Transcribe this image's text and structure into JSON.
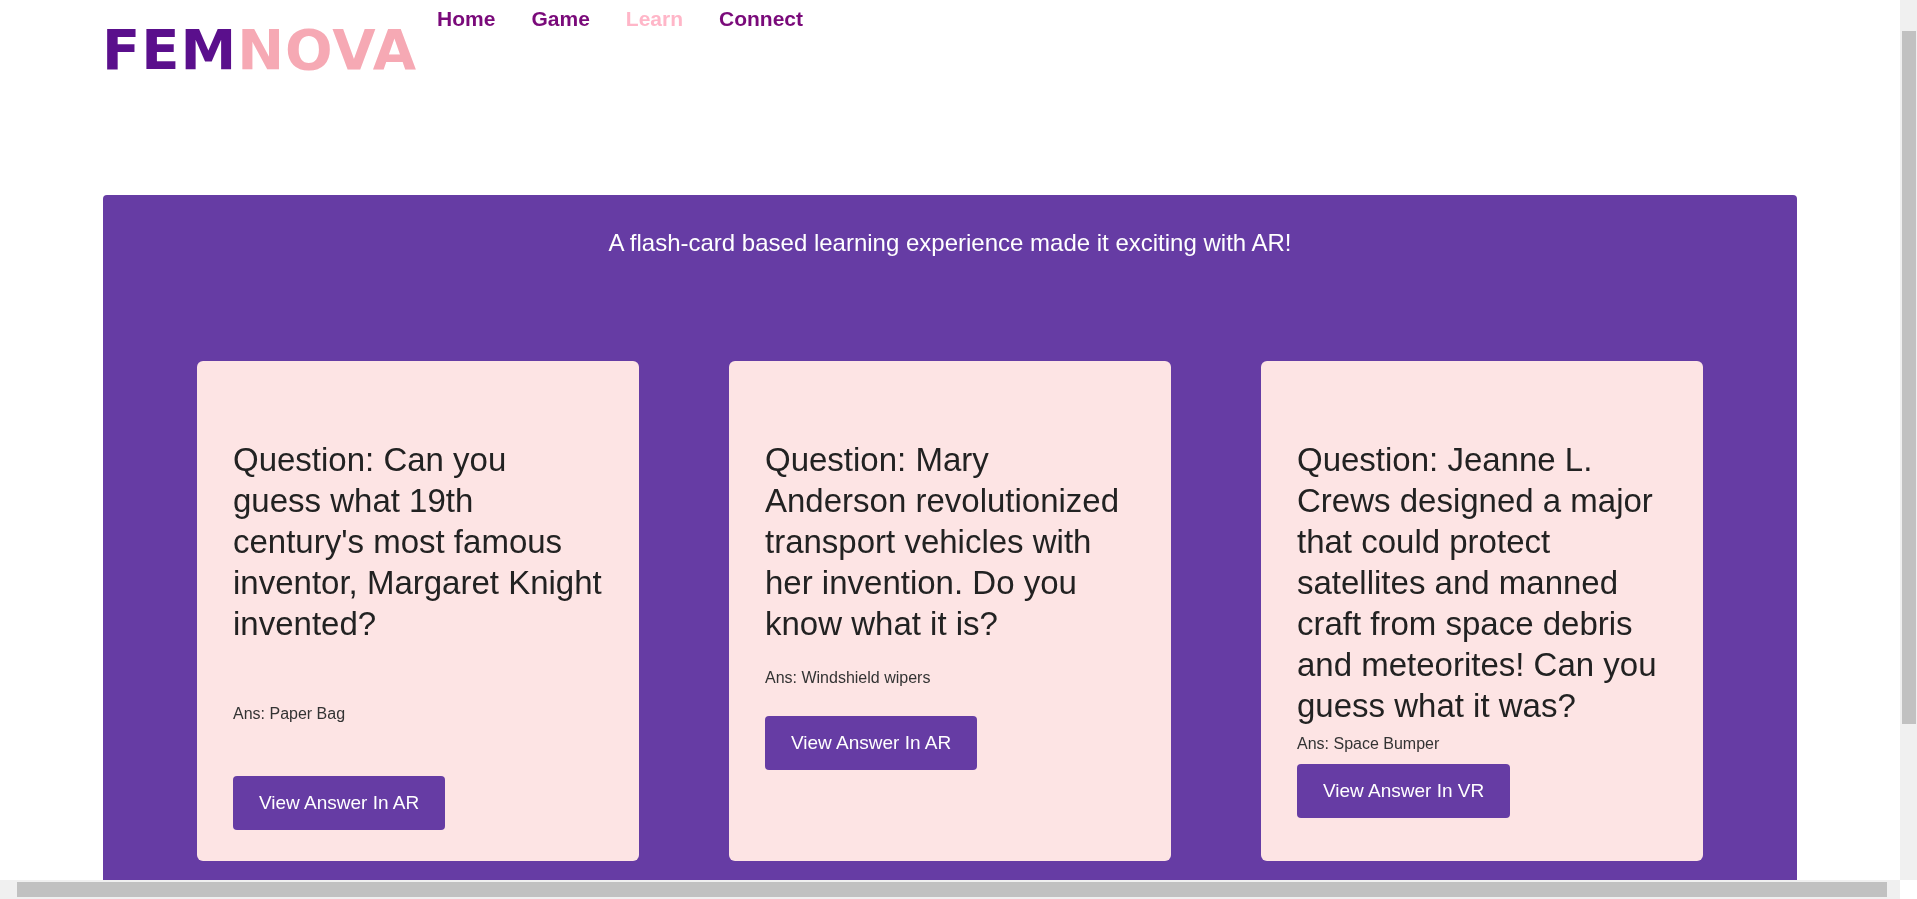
{
  "logo": {
    "part_1": "FEM",
    "part_2": "NOVA"
  },
  "nav": [
    {
      "label": "Home",
      "selected": false
    },
    {
      "label": "Game",
      "selected": false
    },
    {
      "label": "Learn",
      "selected": true
    },
    {
      "label": "Connect",
      "selected": false
    }
  ],
  "intro": "A flash-card based learning experience made it exciting with AR!",
  "cards": [
    {
      "question": "Question: Can you guess what 19th century's most famous inventor, Margaret Knight invented?",
      "answer": "Ans: Paper Bag",
      "button": "View Answer In AR"
    },
    {
      "question": "Question: Mary Anderson revolutionized transport vehicles with her invention. Do you know what it is?",
      "answer": "Ans: Windshield wipers",
      "button": "View Answer In AR"
    },
    {
      "question": "Question: Jeanne L. Crews designed a major that could protect satellites and manned craft from space debris and meteorites! Can you guess what it was?",
      "answer": "Ans: Space Bumper",
      "button": "View Answer In VR"
    }
  ]
}
